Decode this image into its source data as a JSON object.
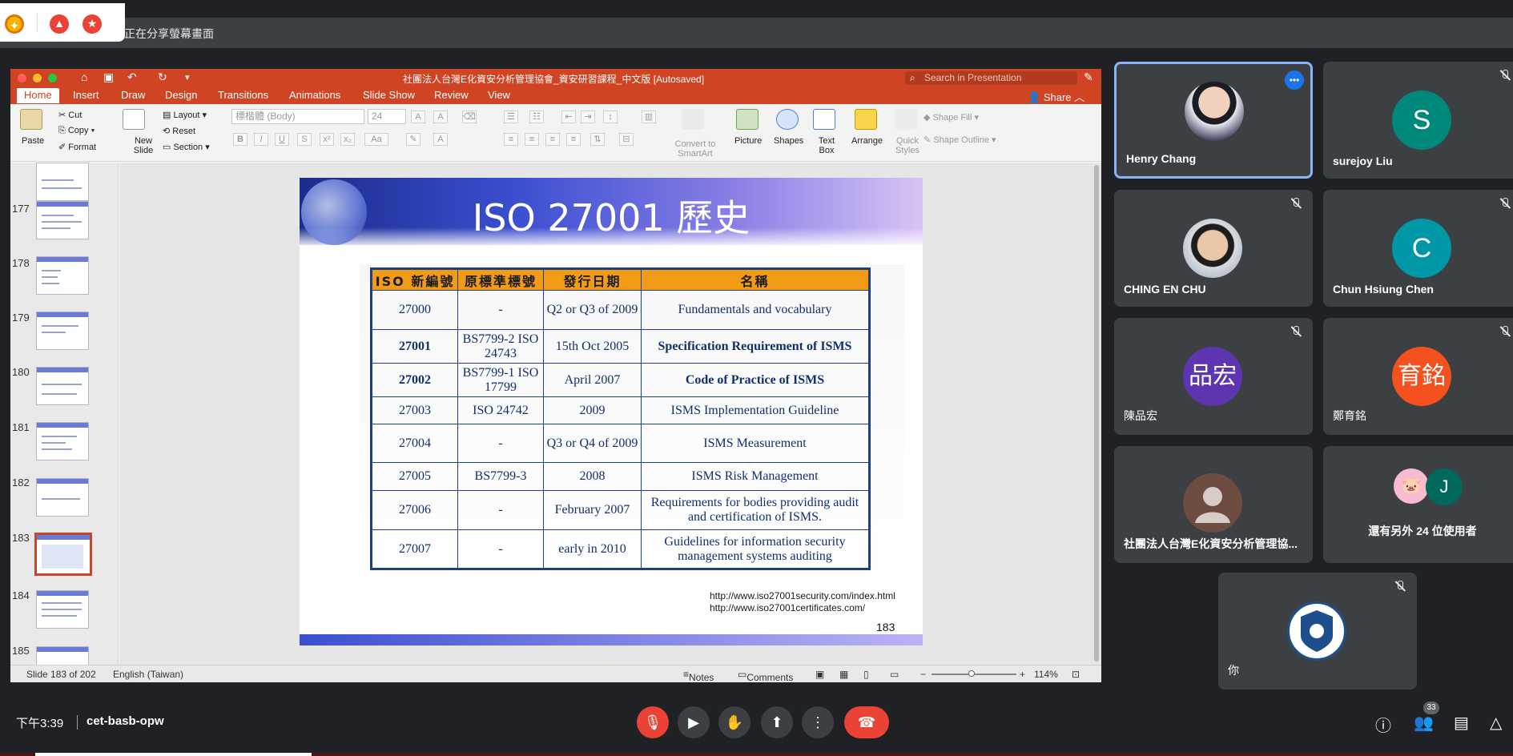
{
  "meet_top": {
    "sharing_text": "正在分享螢幕畫面"
  },
  "ppt": {
    "doc_title": "社團法人台灣E化資安分析管理協會_資安研習課程_中文版 [Autosaved]",
    "search_placeholder": "Search in Presentation",
    "share": "Share",
    "tabs": [
      "Home",
      "Insert",
      "Draw",
      "Design",
      "Transitions",
      "Animations",
      "Slide Show",
      "Review",
      "View"
    ],
    "ribbon": {
      "paste": "Paste",
      "cut": "Cut",
      "copy": "Copy",
      "format": "Format",
      "new_slide": "New Slide",
      "layout": "Layout",
      "reset": "Reset",
      "section": "Section",
      "font": "標楷體 (Body)",
      "font_size": "24",
      "convert": "Convert to SmartArt",
      "picture": "Picture",
      "shapes": "Shapes",
      "text_box": "Text Box",
      "arrange": "Arrange",
      "quick_styles": "Quick Styles",
      "shape_fill": "Shape Fill",
      "shape_outline": "Shape Outline"
    },
    "thumb_numbers": [
      "177",
      "178",
      "179",
      "180",
      "181",
      "182",
      "183",
      "184",
      "185"
    ],
    "slide": {
      "title": "ISO 27001 歷史",
      "headers": [
        "ISO 新編號",
        "原標準標號",
        "發行日期",
        "名稱"
      ],
      "rows": [
        [
          "27000",
          "-",
          "Q2 or Q3 of 2009",
          "Fundamentals and vocabulary"
        ],
        [
          "27001",
          "BS7799-2 ISO 24743",
          "15th Oct 2005",
          "Specification Requirement of ISMS"
        ],
        [
          "27002",
          "BS7799-1 ISO 17799",
          "April 2007",
          "Code of Practice of ISMS"
        ],
        [
          "27003",
          "ISO 24742",
          "2009",
          "ISMS Implementation Guideline"
        ],
        [
          "27004",
          "-",
          "Q3 or Q4 of 2009",
          "ISMS Measurement"
        ],
        [
          "27005",
          "BS7799-3",
          "2008",
          "ISMS Risk Management"
        ],
        [
          "27006",
          "-",
          "February 2007",
          "Requirements for bodies providing audit and certification of ISMS."
        ],
        [
          "27007",
          "-",
          "early in 2010",
          "Guidelines for information security management systems auditing"
        ]
      ],
      "url1": "http://www.iso27001security.com/index.html",
      "url2": "http://www.iso27001certificates.com/",
      "number": "183"
    },
    "status": {
      "slide_pos": "Slide 183 of 202",
      "language": "English (Taiwan)",
      "notes": "Notes",
      "comments": "Comments",
      "zoom": "114%"
    }
  },
  "participants": [
    {
      "name": "Henry Chang"
    },
    {
      "name": "surejoy Liu",
      "initial": "S",
      "color": "#00897b"
    },
    {
      "name": "CHING EN CHU"
    },
    {
      "name": "Chun Hsiung Chen",
      "initial": "C",
      "color": "#0097a7"
    },
    {
      "name": "陳品宏",
      "initial": "品宏",
      "color": "#5e35b1"
    },
    {
      "name": "鄭育銘",
      "initial": "育銘",
      "color": "#f4511e"
    },
    {
      "name": "社團法人台灣E化資安分析管理協..."
    },
    {
      "name": "還有另外 24 位使用者",
      "initial": "J",
      "color": "#00695c"
    },
    {
      "name": "你"
    }
  ],
  "bottom": {
    "time": "下午3:39",
    "meeting_code": "cet-basb-opw",
    "people_count": "33"
  }
}
